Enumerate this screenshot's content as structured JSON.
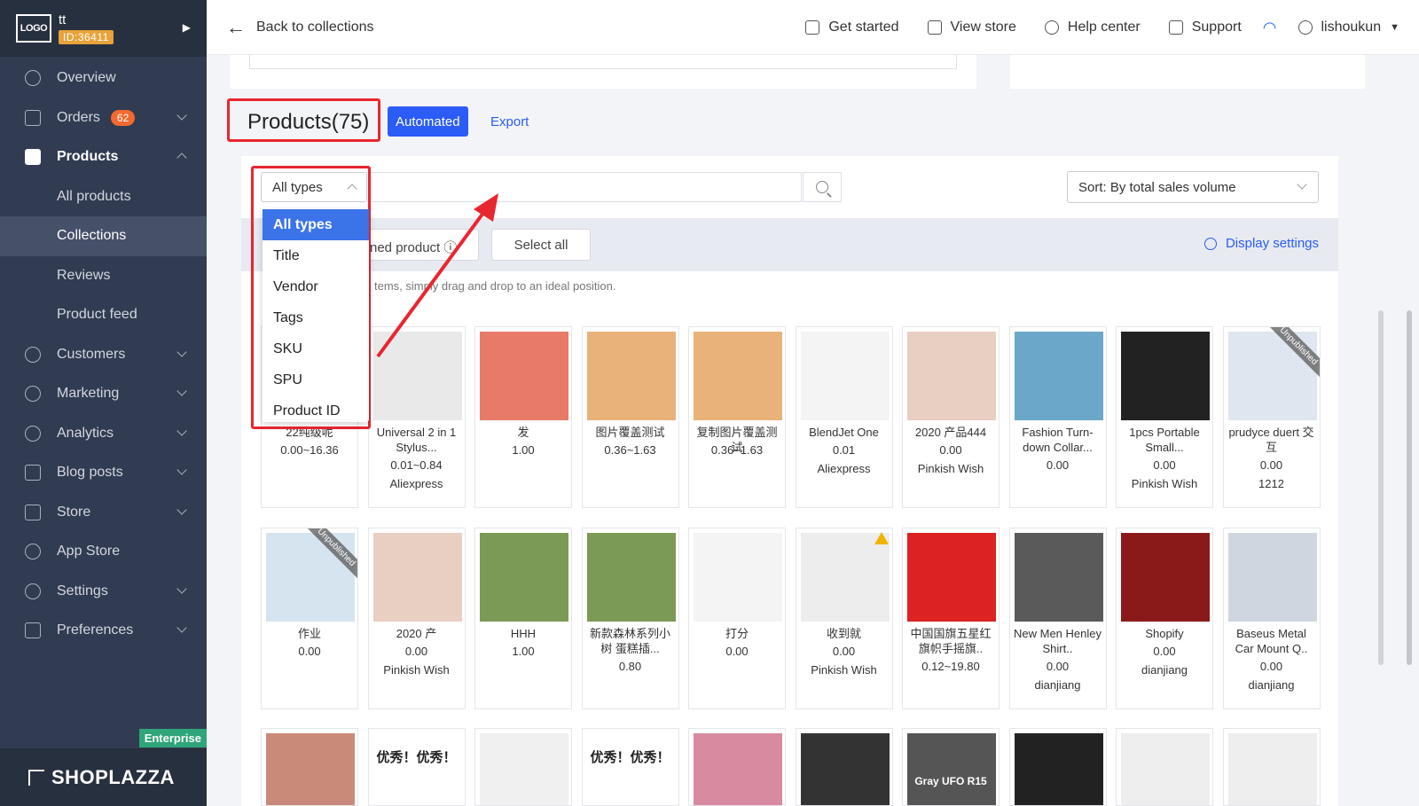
{
  "store": {
    "logo": "LOGO",
    "name": "tt",
    "id": "ID:36411"
  },
  "nav": [
    {
      "label": "Overview"
    },
    {
      "label": "Orders",
      "badge": "62"
    },
    {
      "label": "Products"
    },
    {
      "label": "All products"
    },
    {
      "label": "Collections"
    },
    {
      "label": "Reviews"
    },
    {
      "label": "Product feed"
    },
    {
      "label": "Customers"
    },
    {
      "label": "Marketing"
    },
    {
      "label": "Analytics"
    },
    {
      "label": "Blog posts"
    },
    {
      "label": "Store"
    },
    {
      "label": "App Store"
    },
    {
      "label": "Settings"
    },
    {
      "label": "Preferences"
    }
  ],
  "brand": {
    "name": "SHOPLAZZA",
    "plan": "Enterprise"
  },
  "topbar": {
    "back": "Back to collections",
    "get_started": "Get started",
    "view_store": "View store",
    "help": "Help center",
    "support": "Support",
    "user": "lishoukun"
  },
  "page": {
    "title": "Products(75)",
    "automated": "Automated",
    "export": "Export"
  },
  "filters": {
    "type_selected": "All types",
    "sort": "Sort: By total sales volume",
    "pinned": "ned product",
    "select_all": "Select all",
    "display_settings": "Display settings",
    "hint": "tems, simply drag and drop to an ideal position."
  },
  "type_options": [
    "All types",
    "Title",
    "Vendor",
    "Tags",
    "SKU",
    "SPU",
    "Product ID"
  ],
  "products_row1": [
    {
      "name": "22纯级呢",
      "price": "0.00~16.36",
      "vendor": ""
    },
    {
      "name": "Universal 2 in 1 Stylus...",
      "price": "0.01~0.84",
      "vendor": "Aliexpress"
    },
    {
      "name": "发",
      "price": "1.00",
      "vendor": ""
    },
    {
      "name": "图片覆盖测试",
      "price": "0.36~1.63",
      "vendor": ""
    },
    {
      "name": "复制图片覆盖测试",
      "price": "0.36~1.63",
      "vendor": ""
    },
    {
      "name": "BlendJet One",
      "price": "0.01",
      "vendor": "Aliexpress"
    },
    {
      "name": "2020 产品444",
      "price": "0.00",
      "vendor": "Pinkish Wish"
    },
    {
      "name": "Fashion Turn-down Collar...",
      "price": "0.00",
      "vendor": ""
    },
    {
      "name": "1pcs Portable Small...",
      "price": "0.00",
      "vendor": "Pinkish Wish"
    },
    {
      "name": "prudyce duert 交互",
      "price": "0.00",
      "vendor": "1212",
      "ribbon": "Unpublished"
    }
  ],
  "products_row2": [
    {
      "name": "作业",
      "price": "0.00",
      "vendor": "",
      "ribbon": "Unpublished"
    },
    {
      "name": "2020 产",
      "price": "0.00",
      "vendor": "Pinkish Wish"
    },
    {
      "name": "HHH",
      "price": "1.00",
      "vendor": ""
    },
    {
      "name": "新款森林系列小树 蛋糕插...",
      "price": "0.80",
      "vendor": ""
    },
    {
      "name": "打分",
      "price": "0.00",
      "vendor": ""
    },
    {
      "name": "收到就",
      "price": "0.00",
      "vendor": "Pinkish Wish",
      "warn": true
    },
    {
      "name": "中国国旗五星红旗帜手摇旗..",
      "price": "0.12~19.80",
      "vendor": ""
    },
    {
      "name": "New Men Henley Shirt..",
      "price": "0.00",
      "vendor": "dianjiang"
    },
    {
      "name": "Shopify",
      "price": "0.00",
      "vendor": "dianjiang"
    },
    {
      "name": "Baseus Metal Car Mount Q..",
      "price": "0.00",
      "vendor": "dianjiang"
    }
  ],
  "products_row3_captions": [
    "",
    "优秀！优秀！",
    "",
    "优秀！优秀！",
    "",
    "",
    "Gray UFO R15",
    "",
    "",
    ""
  ],
  "colors": {
    "sidebar": "#313b52",
    "accent": "#2b5cf5",
    "annotation": "#e8262f",
    "badge": "#f26a2f"
  }
}
